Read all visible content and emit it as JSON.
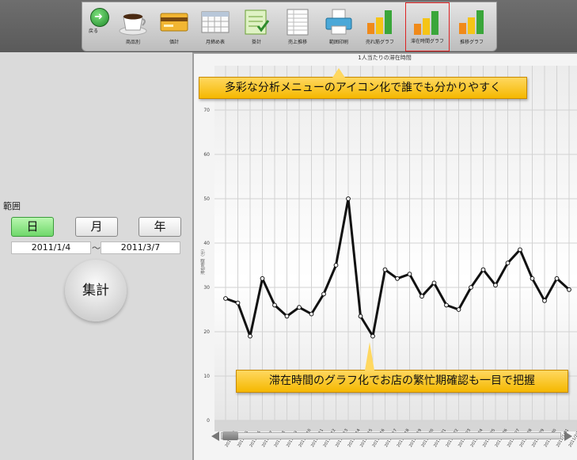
{
  "toolbar": {
    "back_label": "戻る",
    "items": [
      {
        "label": "商品別",
        "icon": "coffee-cup-icon"
      },
      {
        "label": "価計",
        "icon": "credit-card-icon"
      },
      {
        "label": "月締め表",
        "icon": "calendar-grid-icon"
      },
      {
        "label": "掛計",
        "icon": "ledger-check-icon"
      },
      {
        "label": "売上推移",
        "icon": "spreadsheet-icon"
      },
      {
        "label": "範囲印刷",
        "icon": "printer-icon"
      },
      {
        "label": "売れ筋グラフ",
        "icon": "bar-graph-icon"
      },
      {
        "label": "滞在時間グラフ",
        "icon": "bar-graph-icon"
      },
      {
        "label": "推移グラフ",
        "icon": "bar-graph-icon"
      }
    ],
    "selected": "滞在時間グラフ"
  },
  "left_panel": {
    "range_label": "範囲",
    "period_buttons": [
      "日",
      "月",
      "年"
    ],
    "active_period": "日",
    "date_from": "2011/1/4",
    "date_separator": "～",
    "date_to": "2011/3/7",
    "aggregate_label": "集計"
  },
  "callouts": {
    "top": "多彩な分析メニューのアイコン化で誰でも分かりやすく",
    "bottom": "滞在時間のグラフ化でお店の繁忙期確認も一目で把握"
  },
  "colors": {
    "callout": "#f5b800",
    "active_period": "#6fd86a",
    "selected_outline": "#dd2222"
  },
  "chart_data": {
    "type": "line",
    "title": "1人当たりの滞在時間",
    "ylabel": "滞在時間（分）",
    "ylim": [
      0,
      75
    ],
    "yticks": [
      0,
      10,
      20,
      30,
      40,
      50,
      60,
      70
    ],
    "grid": true,
    "categories": [
      "2011/1/4",
      "2011/1/5",
      "2011/1/6",
      "2011/1/7",
      "2011/1/8",
      "2011/1/9",
      "2011/1/10",
      "2011/1/11",
      "2011/1/12",
      "2011/1/13",
      "2011/1/14",
      "2011/1/15",
      "2011/1/16",
      "2011/1/17",
      "2011/1/18",
      "2011/1/19",
      "2011/1/20",
      "2011/1/21",
      "2011/1/22",
      "2011/1/23",
      "2011/1/24",
      "2011/1/25",
      "2011/1/26",
      "2011/1/27",
      "2011/1/28",
      "2011/1/29",
      "2011/1/30",
      "2011/1/31",
      "2011/2/1"
    ],
    "values": [
      27.5,
      26.5,
      19,
      32,
      26,
      23.5,
      25.5,
      24,
      28.5,
      35,
      50,
      23.5,
      19,
      34,
      32,
      33,
      28,
      31,
      26,
      25,
      30,
      34,
      30.5,
      35.5,
      38.5,
      32,
      27,
      32,
      29.5
    ]
  }
}
